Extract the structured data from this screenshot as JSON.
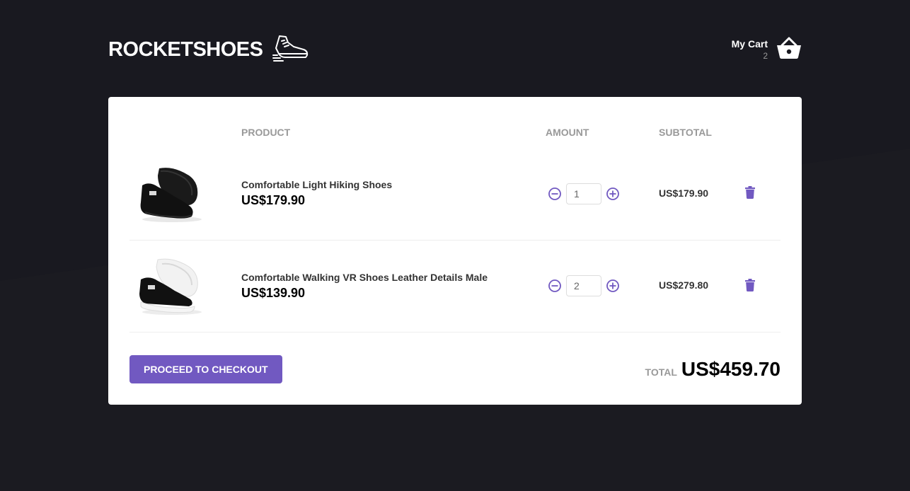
{
  "header": {
    "logo_text": "ROCKETSHOES",
    "cart_title": "My Cart",
    "cart_count": "2"
  },
  "table": {
    "headers": [
      "PRODUCT",
      "AMOUNT",
      "SUBTOTAL"
    ],
    "rows": [
      {
        "name": "Comfortable Light Hiking Shoes",
        "price": "US$179.90",
        "amount": "1",
        "subtotal": "US$179.90"
      },
      {
        "name": "Comfortable Walking VR Shoes Leather Details Male",
        "price": "US$139.90",
        "amount": "2",
        "subtotal": "US$279.80"
      }
    ]
  },
  "footer": {
    "checkout_label": "PROCEED TO CHECKOUT",
    "total_label": "TOTAL",
    "total_value": "US$459.70"
  },
  "colors": {
    "background": "#191920",
    "accent": "#7159c1"
  },
  "icons": {
    "logo": "sneaker-icon",
    "cart": "shopping-basket-icon",
    "decrement": "minus-circle-icon",
    "increment": "plus-circle-icon",
    "delete": "trash-icon"
  }
}
